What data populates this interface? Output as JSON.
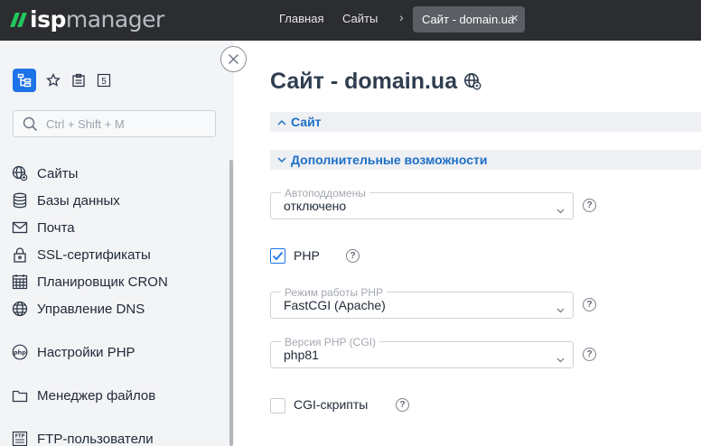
{
  "app": {
    "logo_prefix": "isp",
    "logo_suffix": "manager",
    "brand_color": "#22c55e",
    "accent_color": "#1e73e8"
  },
  "breadcrumbs": [
    {
      "label": "Главная"
    },
    {
      "label": "Сайты"
    },
    {
      "label": "Сайт - domain.ua"
    }
  ],
  "sidebar": {
    "top_icons": [
      "tree-icon",
      "star-icon",
      "clipboard-icon",
      "badge-five-icon"
    ],
    "badge_count": "5",
    "search_placeholder": "Ctrl + Shift + M",
    "items": [
      {
        "label": "Сайты",
        "icon": "globe-icon"
      },
      {
        "label": "Базы данных",
        "icon": "database-icon"
      },
      {
        "label": "Почта",
        "icon": "mail-icon"
      },
      {
        "label": "SSL-сертификаты",
        "icon": "lock-icon"
      },
      {
        "label": "Планировщик CRON",
        "icon": "calendar-icon"
      },
      {
        "label": "Управление DNS",
        "icon": "dns-globe-icon"
      },
      {
        "label": "Настройки PHP",
        "icon": "php-icon"
      },
      {
        "label": "Менеджер файлов",
        "icon": "folder-icon"
      },
      {
        "label": "FTP-пользователи",
        "icon": "ftp-icon"
      }
    ]
  },
  "main": {
    "title": "Сайт - domain.ua",
    "sections": [
      {
        "label": "Сайт",
        "expanded": false
      },
      {
        "label": "Дополнительные возможности",
        "expanded": true
      }
    ],
    "fields": {
      "autosubdomains": {
        "label": "Автоподдомены",
        "value": "отключено"
      },
      "php": {
        "label": "PHP",
        "checked": true
      },
      "php_mode": {
        "label": "Режим работы PHP",
        "value": "FastCGI (Apache)"
      },
      "php_version": {
        "label": "Версия PHP (CGI)",
        "value": "php81"
      },
      "cgi": {
        "label": "CGI-скрипты",
        "checked": false
      }
    },
    "help_symbol": "?"
  }
}
